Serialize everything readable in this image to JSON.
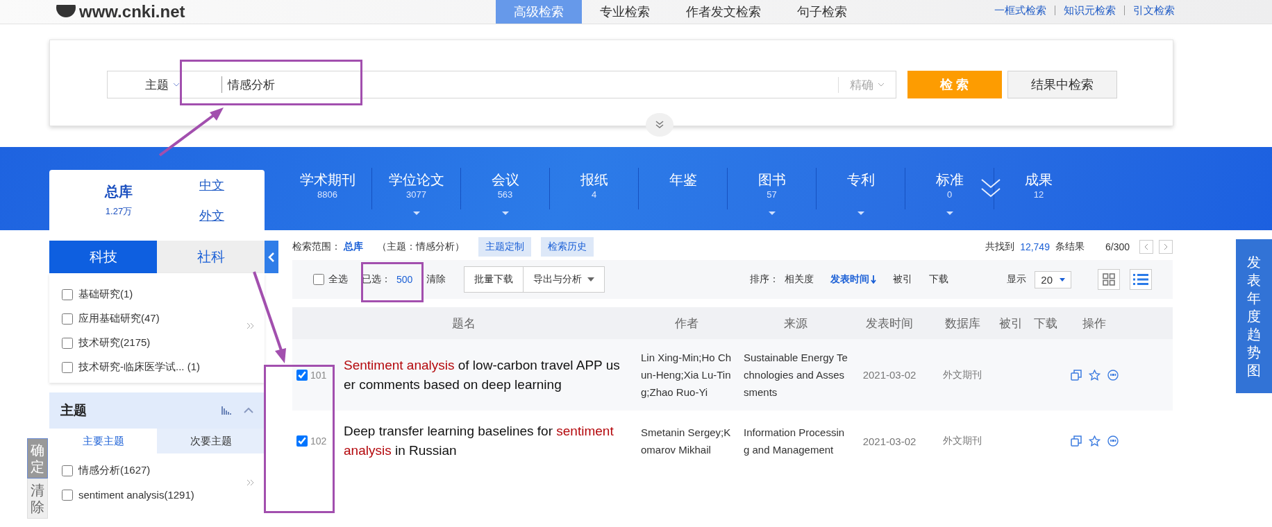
{
  "site": {
    "url": "www.cnki.net"
  },
  "nav_tabs": [
    {
      "label": "高级检索",
      "selected": true
    },
    {
      "label": "专业检索",
      "selected": false
    },
    {
      "label": "作者发文检索",
      "selected": false
    },
    {
      "label": "句子检索",
      "selected": false
    }
  ],
  "nav_links": [
    "一框式检索",
    "知识元检索",
    "引文检索"
  ],
  "search": {
    "field": "主题",
    "value": "情感分析",
    "match": "精确",
    "buttons": [
      "检 索",
      "结果中检索"
    ]
  },
  "databases": {
    "total": {
      "label": "总库",
      "count": "1.27万"
    },
    "lang_links": [
      "中文",
      "外文"
    ],
    "items": [
      {
        "label": "学术期刊",
        "count": "8806",
        "has_menu": false
      },
      {
        "label": "学位论文",
        "count": "3077",
        "has_menu": true
      },
      {
        "label": "会议",
        "count": "563",
        "has_menu": true
      },
      {
        "label": "报纸",
        "count": "4",
        "has_menu": false
      },
      {
        "label": "年鉴",
        "has_menu": false
      },
      {
        "label": "图书",
        "count": "57",
        "has_menu": true
      },
      {
        "label": "专利",
        "has_menu": true
      },
      {
        "label": "标准",
        "count": "0",
        "has_menu": true
      },
      {
        "label": "成果",
        "count": "12",
        "has_menu": false
      }
    ]
  },
  "sidebar": {
    "tabs": [
      {
        "label": "科技",
        "selected": true
      },
      {
        "label": "社科",
        "selected": false
      }
    ],
    "items": [
      {
        "label": "基础研究(1)",
        "checked": false
      },
      {
        "label": "应用基础研究(47)",
        "checked": false
      },
      {
        "label": "技术研究(2175)",
        "checked": false
      },
      {
        "label": "技术研究-临床医学试...  (1)",
        "checked": false
      }
    ],
    "topic": {
      "title": "主题",
      "tabs": [
        {
          "label": "主要主题",
          "selected": true
        },
        {
          "label": "次要主题",
          "selected": false
        }
      ],
      "items": [
        {
          "label": "情感分析(1627)",
          "checked": false
        },
        {
          "label": "sentiment analysis(1291)",
          "checked": false
        }
      ]
    }
  },
  "side_buttons": [
    {
      "label": "确定",
      "kind": "primary"
    },
    {
      "label": "清除",
      "kind": "plain"
    }
  ],
  "results": {
    "scope_label": "检索范围：",
    "scope": "总库",
    "query": "（主题：情感分析）",
    "buttons": [
      "主题定制",
      "检索历史"
    ],
    "found_prefix": "共找到",
    "total": "12,749",
    "found_suffix": "条结果",
    "page": "6/300"
  },
  "toolbar": {
    "select_all": {
      "label": "全选",
      "checked": false
    },
    "selected_label": "已选：",
    "selected_count": "500",
    "clear": "清除",
    "buttons": [
      {
        "label": "批量下载",
        "dropdown": false
      },
      {
        "label": "导出与分析",
        "dropdown": true
      }
    ],
    "sort_label": "排序：",
    "sort": [
      {
        "label": "相关度",
        "selected": false
      },
      {
        "label": "发表时间",
        "selected": true
      },
      {
        "label": "被引",
        "selected": false
      },
      {
        "label": "下载",
        "selected": false
      }
    ],
    "display_label": "显示",
    "page_size": "20",
    "views": [
      {
        "kind": "grid",
        "selected": false
      },
      {
        "kind": "list",
        "selected": true
      }
    ]
  },
  "table": {
    "columns": [
      "题名",
      "作者",
      "来源",
      "发表时间",
      "数据库",
      "被引",
      "下载",
      "操作"
    ],
    "rows": [
      {
        "checked": true,
        "number": "101",
        "title": [
          {
            "text": "Sentiment analysis",
            "highlight": true
          },
          {
            "text": " of low-carbon travel APP user comments based on deep learning",
            "highlight": false
          }
        ],
        "authors": "Lin Xing-Min;Ho Chun-Heng;Xia Lu-Ting;Zhao Ruo-Yi",
        "source": "Sustainable Energy Technologies and Assessments",
        "date": "2021-03-02",
        "database": "外文期刊"
      },
      {
        "checked": true,
        "number": "102",
        "title": [
          {
            "text": "Deep transfer learning baselines for ",
            "highlight": false
          },
          {
            "text": "sentiment analysis",
            "highlight": true
          },
          {
            "text": " in Russian",
            "highlight": false
          }
        ],
        "authors": "Smetanin Sergey;Komarov Mikhail",
        "source": "Information Processing and Management",
        "date": "2021-03-02",
        "database": "外文期刊"
      }
    ]
  },
  "trend_button": "发表年度趋势图"
}
